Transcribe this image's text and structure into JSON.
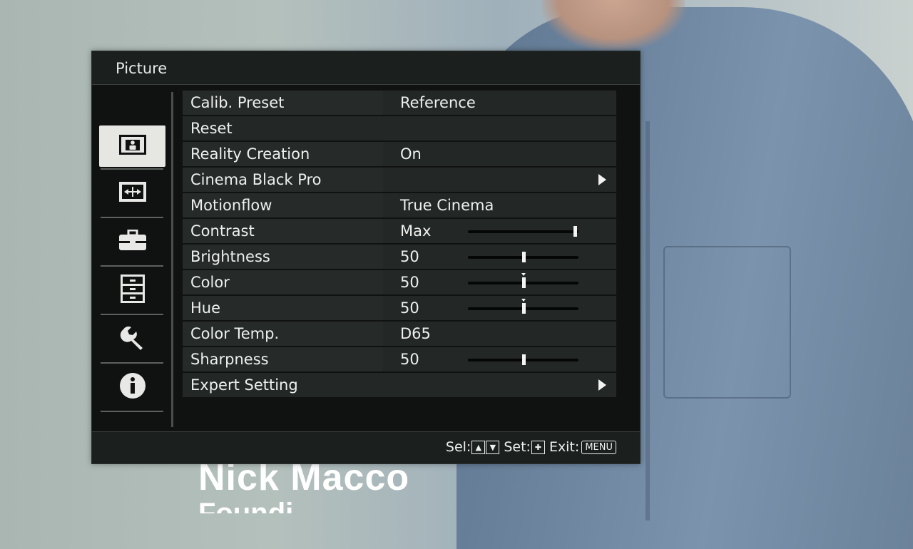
{
  "menu": {
    "title": "Picture",
    "sidebar": [
      {
        "icon": "picture-icon",
        "active": true
      },
      {
        "icon": "screen-icon",
        "active": false
      },
      {
        "icon": "toolbox-icon",
        "active": false
      },
      {
        "icon": "cabinet-icon",
        "active": false
      },
      {
        "icon": "wrench-icon",
        "active": false
      },
      {
        "icon": "info-icon",
        "active": false
      }
    ],
    "rows": [
      {
        "label": "Calib. Preset",
        "value": "Reference"
      },
      {
        "label": "Reset",
        "value": ""
      },
      {
        "label": "Reality Creation",
        "value": "On"
      },
      {
        "label": "Cinema Black Pro",
        "value": "",
        "submenu": true
      },
      {
        "label": "Motionflow",
        "value": "True Cinema"
      },
      {
        "label": "Contrast",
        "value": "Max",
        "slider_percent": 100
      },
      {
        "label": "Brightness",
        "value": "50",
        "slider_percent": 50
      },
      {
        "label": "Color",
        "value": "50",
        "slider_percent": 50,
        "center_mark": true
      },
      {
        "label": "Hue",
        "value": "50",
        "slider_percent": 50,
        "center_mark": true
      },
      {
        "label": "Color Temp.",
        "value": "D65"
      },
      {
        "label": "Sharpness",
        "value": "50",
        "slider_percent": 50
      },
      {
        "label": "Expert Setting",
        "value": "",
        "submenu": true
      }
    ],
    "help": {
      "sel_label": "Sel:",
      "set_label": "Set:",
      "exit_label": "Exit:",
      "menu_key": "MENU"
    }
  },
  "background": {
    "name_text": "Nick Macco",
    "subtitle_text": "Foundi"
  }
}
